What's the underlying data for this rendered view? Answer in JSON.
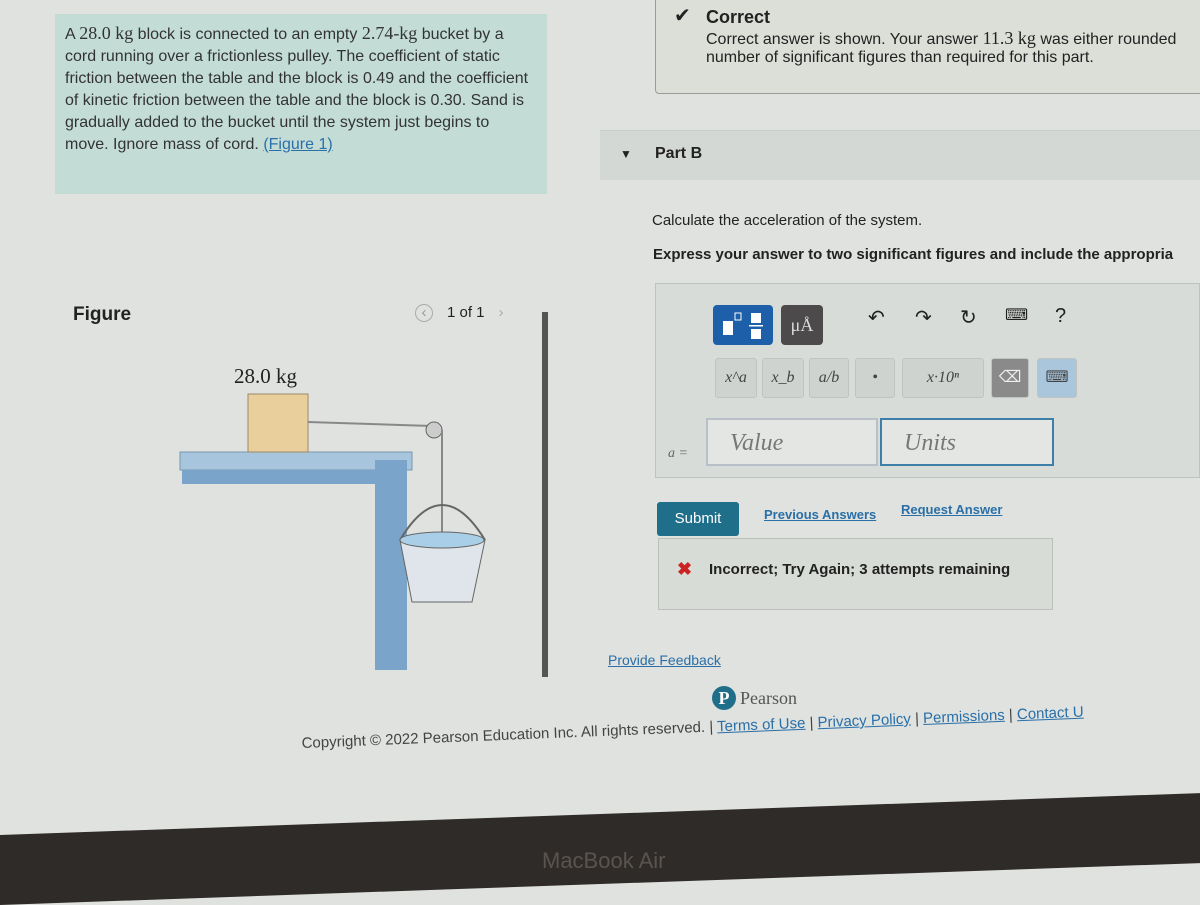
{
  "problem": {
    "pre": "A ",
    "m1": "28.0 kg",
    "t1": " block is connected to an empty ",
    "m2": "2.74-kg",
    "t2": " bucket by a cord running over a frictionless pulley. The coefficient of static friction between the table and the block is 0.49 and the coefficient of kinetic friction between the table and the block is 0.30. Sand is gradually added to the bucket until the system just begins to move. Ignore mass of cord. ",
    "figure_link": "(Figure 1)"
  },
  "feedback": {
    "title": "Correct",
    "line_pre": "Correct answer is shown. Your answer ",
    "value": "11.3 kg",
    "line_post": " was either rounded",
    "line2": "number of significant figures than required for this part."
  },
  "part": {
    "label": "Part B",
    "question": "Calculate the acceleration of the system.",
    "instruction": "Express your answer to two significant figures and include the appropria"
  },
  "toolbar": {
    "units_btn": "μÅ",
    "help": "?",
    "keys": [
      "x^a",
      "x_b",
      "a/b",
      "•",
      "x·10ⁿ"
    ]
  },
  "answer": {
    "variable": "a =",
    "value_placeholder": "Value",
    "units_placeholder": "Units"
  },
  "actions": {
    "submit": "Submit",
    "previous": "Previous Answers",
    "request": "Request Answer"
  },
  "result": {
    "text": "Incorrect; Try Again; 3 attempts remaining"
  },
  "figure": {
    "title": "Figure",
    "pager": "1 of 1",
    "block_label": "28.0 kg"
  },
  "feedback_link": "Provide Feedback",
  "brand": "Pearson",
  "footer": {
    "copyright": "Copyright © 2022 Pearson Education Inc. All rights reserved.",
    "links": [
      "Terms of Use",
      "Privacy Policy",
      "Permissions",
      "Contact U"
    ]
  },
  "bezel": "MacBook Air"
}
